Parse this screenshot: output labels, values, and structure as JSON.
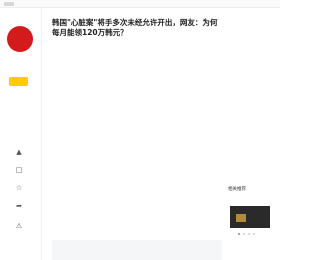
{
  "article": {
    "title": "韩国\"心脏案\"将手多次未经允许开出，网友：为何每月能领120万韩元？"
  },
  "colors": {
    "avatar_bg": "#d41b1b",
    "follow_bg": "#ffcc00",
    "bottom_box_bg": "#f5f6f7"
  },
  "icons": {
    "like": "thumb-up-icon",
    "comment": "comment-icon",
    "favorite": "star-icon",
    "share": "share-icon",
    "report": "warning-icon"
  },
  "rail": {
    "tab_label": "相关推荐"
  }
}
